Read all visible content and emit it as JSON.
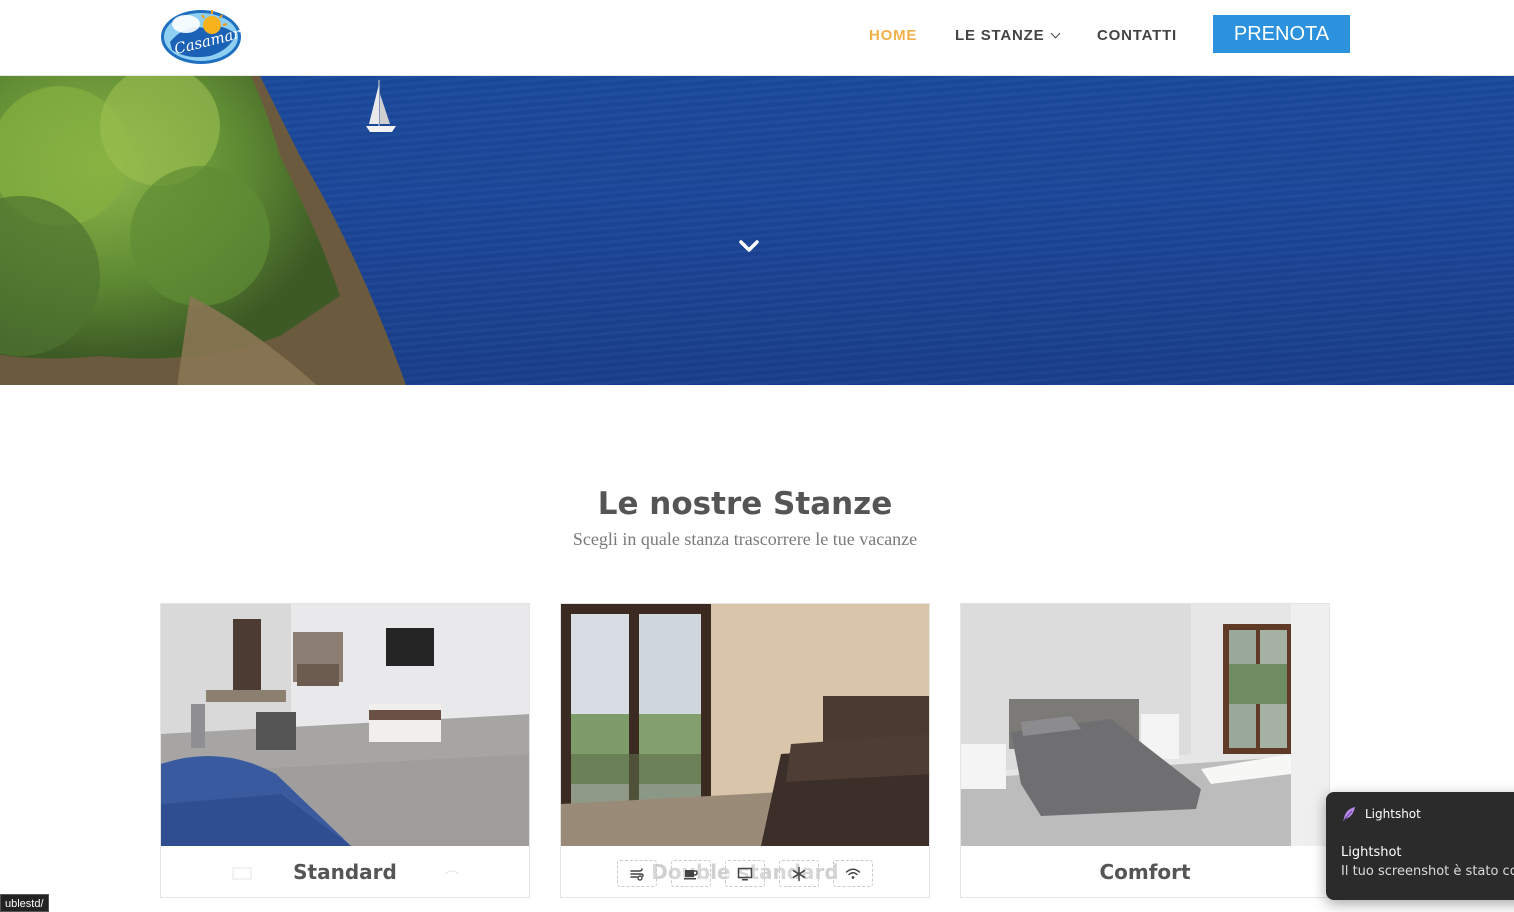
{
  "header": {
    "logo_alt": "Casamar",
    "nav": {
      "home": "HOME",
      "stanze": "LE STANZE",
      "contatti": "CONTATTI"
    },
    "cta": "PRENOTA",
    "active_color": "#f0b04a",
    "cta_color": "#2d92dd"
  },
  "hero": {
    "scroll_icon": "chevron-down-icon"
  },
  "section": {
    "title": "Le nostre Stanze",
    "subtitle": "Scegli in quale stanza trascorrere le tue vacanze"
  },
  "rooms": [
    {
      "title": "Standard"
    },
    {
      "title": "Double standard",
      "amenities": [
        "fan-icon",
        "coffee-icon",
        "tv-icon",
        "snowflake-icon",
        "wifi-icon"
      ]
    },
    {
      "title": "Comfort"
    }
  ],
  "status_bar": {
    "url": "ublestd/"
  },
  "toast": {
    "app": "Lightshot",
    "title": "Lightshot",
    "message": "Il tuo screenshot è stato cop"
  }
}
